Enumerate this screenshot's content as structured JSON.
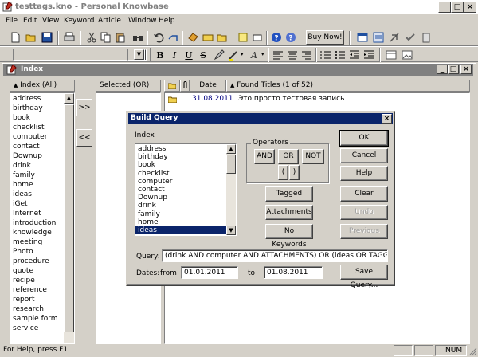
{
  "window": {
    "title": "testtags.kno - Personal Knowbase"
  },
  "menu": [
    "File",
    "Edit",
    "View",
    "Keyword",
    "Article",
    "Window",
    "Help"
  ],
  "toolbar": {
    "buy_now_label": "Buy Now!"
  },
  "formatbar": {
    "bold": "B",
    "italic": "I",
    "underline": "U",
    "strike": "S"
  },
  "panel": {
    "title": "Index"
  },
  "index_column": {
    "header": "Index (All)",
    "items": [
      "address",
      "birthday",
      "book",
      "checklist",
      "computer",
      "contact",
      "Downup",
      "drink",
      "family",
      "home",
      "ideas",
      "iGet",
      "Internet",
      "introduction",
      "knowledge",
      "meeting",
      "Photo",
      "procedure",
      "quote",
      "recipe",
      "reference",
      "report",
      "research",
      "sample form",
      "service"
    ]
  },
  "middle_buttons": {
    "add": ">>",
    "remove": "<<"
  },
  "selected_column": {
    "header": "Selected (OR)"
  },
  "titles_column": {
    "date_header": "Date",
    "titles_header": "Found Titles (1 of 52)",
    "rows": [
      {
        "date": "31.08.2011",
        "title": "Это просто тестовая запись"
      }
    ]
  },
  "dialog": {
    "title": "Build Query",
    "index_label": "Index",
    "index_items": [
      "address",
      "birthday",
      "book",
      "checklist",
      "computer",
      "contact",
      "Downup",
      "drink",
      "family",
      "home",
      "ideas"
    ],
    "selected_item": "ideas",
    "operators_label": "Operators",
    "and_label": "AND",
    "or_label": "OR",
    "not_label": "NOT",
    "open_paren": "(",
    "close_paren": ")",
    "tagged_label": "Tagged",
    "attachments_label": "Attachments",
    "no_keywords_label": "No Keywords",
    "ok_label": "OK",
    "cancel_label": "Cancel",
    "help_label": "Help",
    "clear_label": "Clear",
    "undo_label": "Undo",
    "previous_label": "Previous",
    "query_label": "Query:",
    "query_value": "(drink AND computer AND ATTACHMENTS)  OR (ideas OR TAGGED)",
    "dates_label": "Dates:",
    "from_label": "from",
    "from_value": "01.01.2011",
    "to_label": "to",
    "to_value": "01.08.2011",
    "save_query_label": "Save Query..."
  },
  "status": {
    "help_text": "For Help, press F1",
    "num": "NUM"
  },
  "colors": {
    "title_active": "#0a246a",
    "selection": "#0a246a",
    "date_text": "#000080"
  }
}
